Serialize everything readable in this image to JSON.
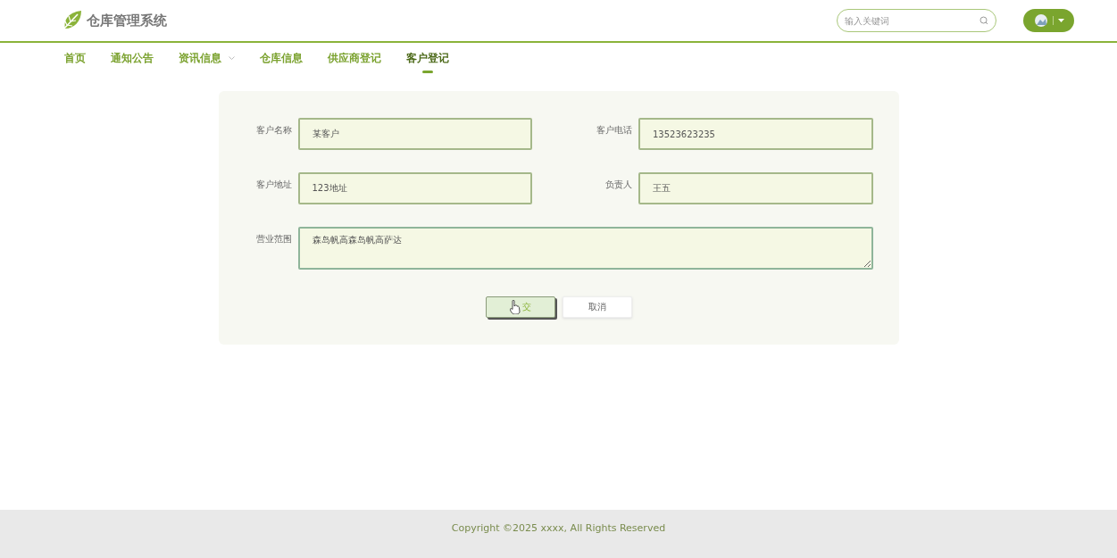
{
  "header": {
    "title": "仓库管理系统",
    "search": {
      "placeholder": "输入关键词"
    }
  },
  "nav": [
    {
      "label": "首页",
      "selected": false,
      "dropdown": false
    },
    {
      "label": "通知公告",
      "selected": false,
      "dropdown": false
    },
    {
      "label": "资讯信息",
      "selected": false,
      "dropdown": true
    },
    {
      "label": "仓库信息",
      "selected": false,
      "dropdown": false
    },
    {
      "label": "供应商登记",
      "selected": false,
      "dropdown": false
    },
    {
      "label": "客户登记",
      "selected": true,
      "dropdown": false
    }
  ],
  "form": {
    "fields": [
      {
        "label": "客户名称",
        "value": "某客户"
      },
      {
        "label": "客户电话",
        "value": "13523623235"
      },
      {
        "label": "客户地址",
        "value": "123地址"
      },
      {
        "label": "负责人",
        "value": "王五"
      }
    ],
    "textarea": {
      "label": "营业范围",
      "value": "森岛帆高森岛帆高萨达"
    },
    "buttons": [
      {
        "kind": "submit",
        "label": "交"
      },
      {
        "kind": "cancel",
        "label": "取消"
      }
    ]
  },
  "footer": {
    "copyright": "Copyright ©2025 xxxx, All Rights Reserved"
  }
}
